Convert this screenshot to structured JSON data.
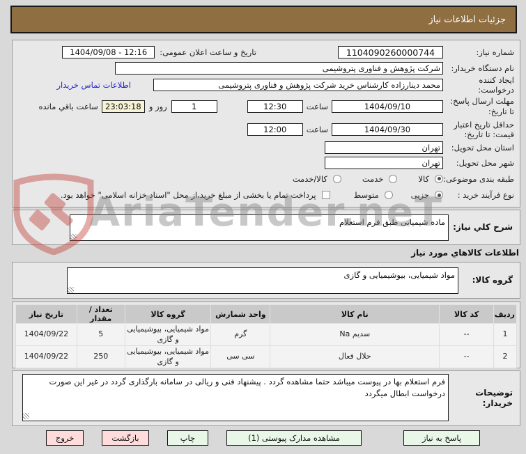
{
  "titlebar": {
    "title": "جزئیات اطلاعات نیاز"
  },
  "watermark": {
    "text": "AriaTender.neT"
  },
  "colors": {
    "titlebar_brown": "#8f6e41",
    "link_blue": "#2222cc",
    "remaining_highlight": "#f7f3d6",
    "button_green": "#e9f7e9",
    "button_pink": "#ffdcdc",
    "watermark_red": "#c23b32"
  },
  "form": {
    "need_number_label": "شماره نیاز:",
    "need_number": "1104090260000744",
    "announce_label": "تاریخ و ساعت اعلان عمومی:",
    "announce_value": "1404/09/08 - 12:16",
    "buyer_org_label": "نام دستگاه خریدار:",
    "buyer_org": "شرکت پژوهش و فناوری پتروشیمی",
    "creator_label": "ایجاد کننده درخواست:",
    "creator": "محمد دینارزاده کارشناس خرید شرکت پژوهش و فناوری پتروشیمی",
    "contact_link": "اطلاعات تماس خریدار",
    "deadline_label": "مهلت ارسال پاسخ: تا تاریخ:",
    "deadline_date": "1404/09/10",
    "hour_label": "ساعت",
    "deadline_hour": "12:30",
    "days_value": "1",
    "days_label": "روز و",
    "remaining_value": "23:03:18",
    "remaining_label": "ساعت باقي مانده",
    "validity_label": "حداقل تاریخ اعتبار قیمت: تا تاریخ:",
    "validity_date": "1404/09/30",
    "validity_hour": "12:00",
    "province_label": "استان محل تحویل:",
    "province": "تهران",
    "city_label": "شهر محل تحویل:",
    "city": "تهران",
    "classification_label": "طبقه بندی موضوعی:",
    "class_goods": "کالا",
    "class_service": "خدمت",
    "class_both": "کالا/خدمت",
    "process_label": "نوع فرآیند خرید :",
    "process_minor": "جزیی",
    "process_medium": "متوسط",
    "treasury_note": "پرداخت تمام یا بخشی از مبلغ خرید،از محل \"اسناد خزانه اسلامی\" خواهد بود."
  },
  "description": {
    "label": "شرح کلي نياز:",
    "value": "ماده شیمیایی طبق فرم استعلام"
  },
  "goods_section": {
    "header": "اطلاعات کالاهاي مورد نياز",
    "group_label": "گروه کالا:",
    "group_value": "مواد شیمیایی، بیوشیمیایی و  گازی"
  },
  "table": {
    "headers": [
      "ردیف",
      "کد کالا",
      "نام کالا",
      "واحد شمارش",
      "گروه کالا",
      "تعداد / مقدار",
      "تاریخ نیاز"
    ],
    "rows": [
      [
        "1",
        "--",
        "سدیم Na",
        "گرم",
        "مواد شیمیایی، بیوشیمیایی و گازی",
        "5",
        "1404/09/22"
      ],
      [
        "2",
        "--",
        "حلال فعال",
        "سی سی",
        "مواد شیمیایی، بیوشیمیایی و گازی",
        "250",
        "1404/09/22"
      ]
    ]
  },
  "notes": {
    "label": "توضیحات خریدار:",
    "value": "فرم استعلام بها در پیوست میباشد حتما مشاهده گردد . پیشنهاد فنی و ریالی در سامانه بارگذاری گردد در غیر این صورت درخواست ابطال میگردد"
  },
  "buttons": {
    "respond": "پاسخ به نیاز",
    "view_docs": "مشاهده مدارک پیوستی (1)",
    "print": "چاپ",
    "back": "بازگشت",
    "exit": "خروج"
  }
}
